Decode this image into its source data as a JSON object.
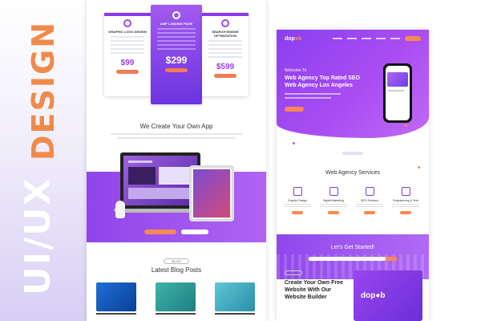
{
  "headline": {
    "ui_ux": "UI/UX",
    "design": "DESIGN"
  },
  "left_mockup": {
    "pricing": [
      {
        "title": "GRAPHIC LOGO DESIGN",
        "price": "$99"
      },
      {
        "title": "AMP LANDING PAGE",
        "price": "$299"
      },
      {
        "title": "SEARCH ENGINE OPTIMIZATION",
        "price": "$599"
      }
    ],
    "app_section_title": "We Create Your Own App",
    "blog_pill": "BLOG",
    "blog_title": "Latest Blog Posts"
  },
  "right_mockup": {
    "brand": {
      "left": "dop",
      "accent": "●b"
    },
    "hero": {
      "welcome": "Welcome To",
      "headline": "Web Agency Top Rated SEO Web Agency Los Angeles"
    },
    "services_title": "Web Agency Services",
    "services": [
      {
        "name": "Graphic Design",
        "icon": "graphic-icon"
      },
      {
        "name": "Digital Marketing",
        "icon": "marketing-icon"
      },
      {
        "name": "SEO Services",
        "icon": "seo-icon"
      },
      {
        "name": "Programming & Tech",
        "icon": "code-icon"
      }
    ],
    "cta_title": "Let's Get Started!",
    "builder_tag": "GET STARTED",
    "builder_headline": "Create Your Own Free Website With Our Website Builder",
    "builder_logo": "dop●b"
  },
  "colors": {
    "purple": "#8b3ff0",
    "orange": "#f7894f",
    "lavender": "#d8cff5"
  }
}
